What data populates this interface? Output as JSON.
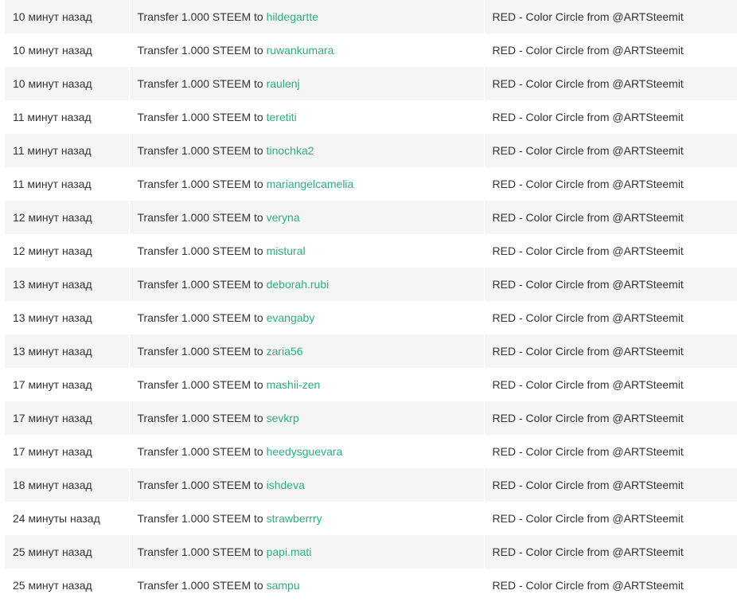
{
  "colors": {
    "row_alt": "#f5f5f5",
    "row_plain": "#ffffff",
    "text": "#333333",
    "link": "#28b17f"
  },
  "rows": [
    {
      "time": "10 минут назад",
      "op_prefix": "Transfer 1.000 STEEM to",
      "user": "hildegartte",
      "memo": "RED - Color Circle from @ARTSteemit"
    },
    {
      "time": "10 минут назад",
      "op_prefix": "Transfer 1.000 STEEM to",
      "user": "ruwankumara",
      "memo": "RED - Color Circle from @ARTSteemit"
    },
    {
      "time": "10 минут назад",
      "op_prefix": "Transfer 1.000 STEEM to",
      "user": "raulenj",
      "memo": "RED - Color Circle from @ARTSteemit"
    },
    {
      "time": "11 минут назад",
      "op_prefix": "Transfer 1.000 STEEM to",
      "user": "teretiti",
      "memo": "RED - Color Circle from @ARTSteemit"
    },
    {
      "time": "11 минут назад",
      "op_prefix": "Transfer 1.000 STEEM to",
      "user": "tinochka2",
      "memo": "RED - Color Circle from @ARTSteemit"
    },
    {
      "time": "11 минут назад",
      "op_prefix": "Transfer 1.000 STEEM to",
      "user": "mariangelcamelia",
      "memo": "RED - Color Circle from @ARTSteemit"
    },
    {
      "time": "12 минут назад",
      "op_prefix": "Transfer 1.000 STEEM to",
      "user": "veryna",
      "memo": "RED - Color Circle from @ARTSteemit"
    },
    {
      "time": "12 минут назад",
      "op_prefix": "Transfer 1.000 STEEM to",
      "user": "mistural",
      "memo": "RED - Color Circle from @ARTSteemit"
    },
    {
      "time": "13 минут назад",
      "op_prefix": "Transfer 1.000 STEEM to",
      "user": "deborah.rubi",
      "memo": "RED - Color Circle from @ARTSteemit"
    },
    {
      "time": "13 минут назад",
      "op_prefix": "Transfer 1.000 STEEM to",
      "user": "evangaby",
      "memo": "RED - Color Circle from @ARTSteemit"
    },
    {
      "time": "13 минут назад",
      "op_prefix": "Transfer 1.000 STEEM to",
      "user": "zaria56",
      "memo": "RED - Color Circle from @ARTSteemit"
    },
    {
      "time": "17 минут назад",
      "op_prefix": "Transfer 1.000 STEEM to",
      "user": "mashii-zen",
      "memo": "RED - Color Circle from @ARTSteemit"
    },
    {
      "time": "17 минут назад",
      "op_prefix": "Transfer 1.000 STEEM to",
      "user": "sevkrp",
      "memo": "RED - Color Circle from @ARTSteemit"
    },
    {
      "time": "17 минут назад",
      "op_prefix": "Transfer 1.000 STEEM to",
      "user": "heedysguevara",
      "memo": "RED - Color Circle from @ARTSteemit"
    },
    {
      "time": "18 минут назад",
      "op_prefix": "Transfer 1.000 STEEM to",
      "user": "ishdeva",
      "memo": "RED - Color Circle from @ARTSteemit"
    },
    {
      "time": "24 минуты назад",
      "op_prefix": "Transfer 1.000 STEEM to",
      "user": "strawberrry",
      "memo": "RED - Color Circle from @ARTSteemit"
    },
    {
      "time": "25 минут назад",
      "op_prefix": "Transfer 1.000 STEEM to",
      "user": "papi.mati",
      "memo": "RED - Color Circle from @ARTSteemit"
    },
    {
      "time": "25 минут назад",
      "op_prefix": "Transfer 1.000 STEEM to",
      "user": "sampu",
      "memo": "RED - Color Circle from @ARTSteemit"
    }
  ]
}
